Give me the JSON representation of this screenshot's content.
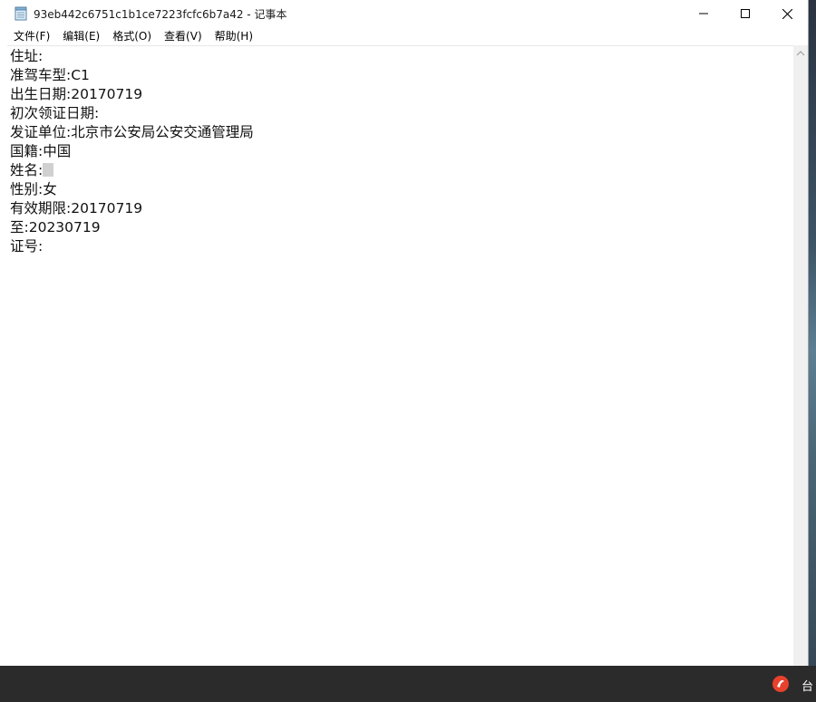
{
  "window": {
    "title": "93eb442c6751c1b1ce7223fcfc6b7a42 - 记事本",
    "icon": "notepad-icon",
    "controls": [
      "minimize-icon",
      "maximize-icon",
      "close-icon"
    ]
  },
  "menu": {
    "file": "文件(F)",
    "edit": "编辑(E)",
    "format": "格式(O)",
    "view": "查看(V)",
    "help": "帮助(H)"
  },
  "content": {
    "lines": [
      "住址:",
      "准驾车型:C1",
      "出生日期:20170719",
      "初次领证日期:",
      "发证单位:北京市公安局公安交通管理局",
      "国籍:中国",
      "姓名:",
      "性别:女",
      "有效期限:20170719",
      "至:20230719",
      "证号:"
    ]
  },
  "taskbar": {
    "tray_text": "台",
    "tray_icon": "app-tray-icon",
    "tray_color": "#e8412c"
  }
}
